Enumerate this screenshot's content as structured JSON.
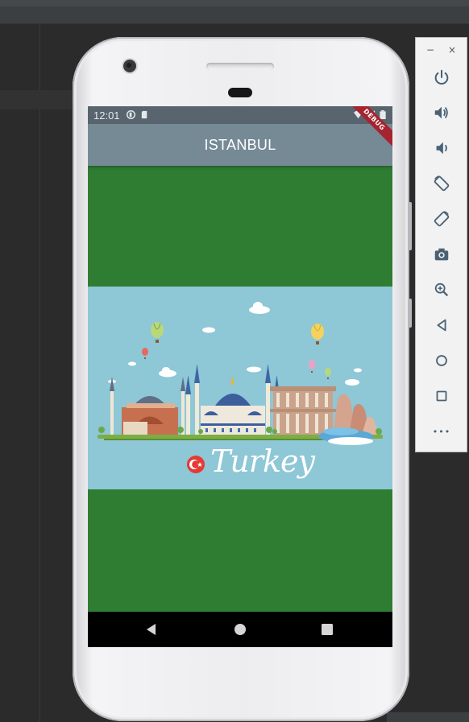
{
  "statusbar": {
    "time": "12:01"
  },
  "debug_banner": "DEBUG",
  "appbar": {
    "title": "ISTANBUL"
  },
  "poster": {
    "caption": "Turkey"
  },
  "toolbar": {
    "minimize": "−",
    "close": "×",
    "more": "•••",
    "buttons": [
      "power-icon",
      "volume-up-icon",
      "volume-down-icon",
      "rotate-left-icon",
      "rotate-right-icon",
      "camera-icon",
      "zoom-icon",
      "back-icon",
      "home-icon",
      "overview-icon",
      "more-icon"
    ]
  },
  "colors": {
    "appbar": "#768a96",
    "statusbar": "#58656f",
    "body_green": "#2f7d32",
    "poster_sky": "#8ec7d6",
    "flag_red": "#e53935"
  }
}
